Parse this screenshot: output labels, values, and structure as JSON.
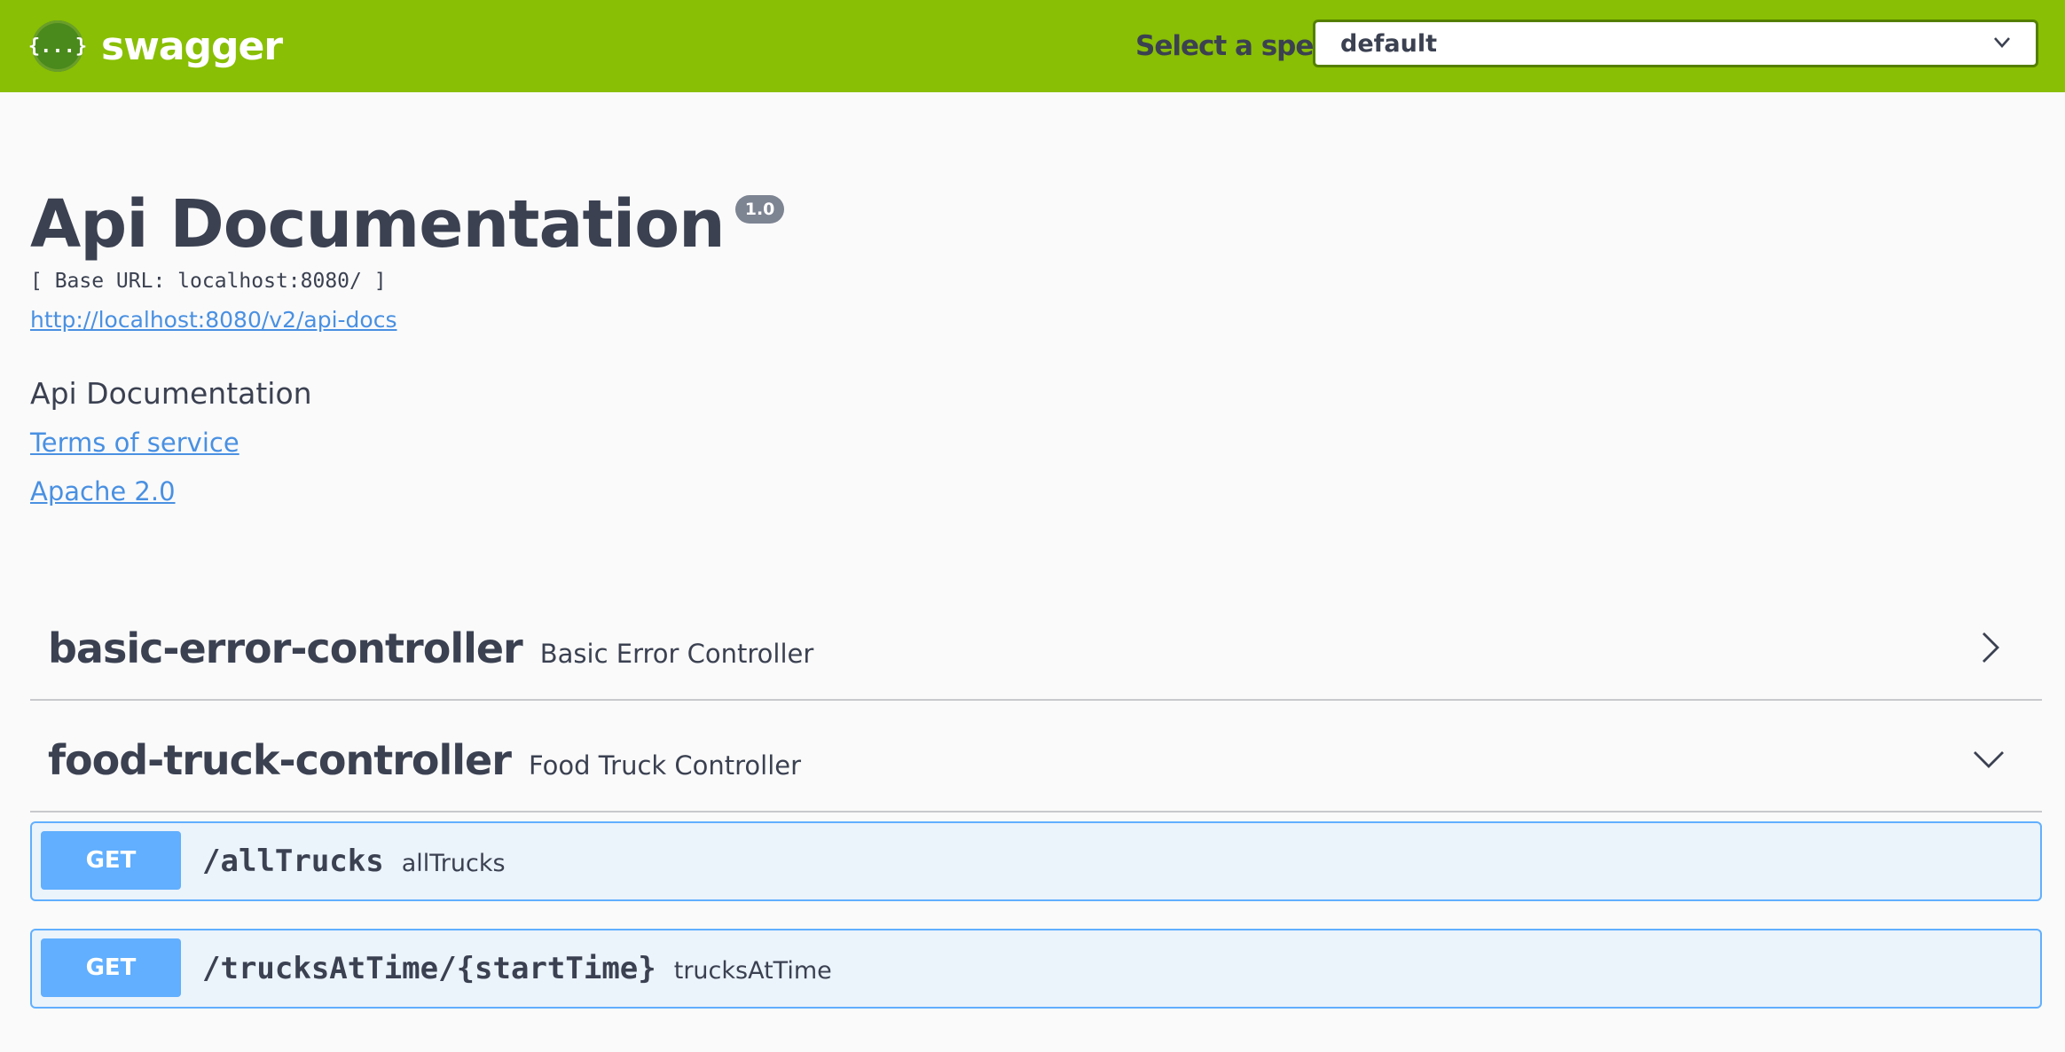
{
  "topbar": {
    "logo_glyph": "{...}",
    "brand": "swagger",
    "spec_label": "Select a spec",
    "spec_selected": "default",
    "accent_color": "#89bf04"
  },
  "info": {
    "title": "Api Documentation",
    "version": "1.0",
    "base_url": "[ Base URL: localhost:8080/ ]",
    "api_docs_url": "http://localhost:8080/v2/api-docs",
    "description": "Api Documentation",
    "terms_label": "Terms of service",
    "license_label": "Apache 2.0"
  },
  "tags": [
    {
      "name": "basic-error-controller",
      "description": "Basic Error Controller",
      "expanded": false,
      "icon": "chevron-right-icon"
    },
    {
      "name": "food-truck-controller",
      "description": "Food Truck Controller",
      "expanded": true,
      "icon": "chevron-down-icon"
    }
  ],
  "operations": [
    {
      "method": "GET",
      "path": "/allTrucks",
      "summary": "allTrucks",
      "color": "#61affe"
    },
    {
      "method": "GET",
      "path": "/trucksAtTime/{startTime}",
      "summary": "trucksAtTime",
      "color": "#61affe"
    }
  ]
}
